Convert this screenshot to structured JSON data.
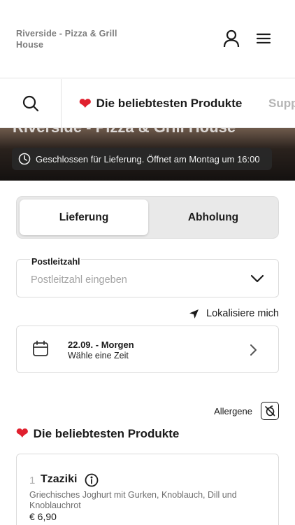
{
  "header": {
    "brand": "Riverside - Pizza & Grill House",
    "account_icon": "user-icon",
    "menu_icon": "hamburger-menu-icon"
  },
  "category_bar": {
    "search_icon": "search-icon",
    "items": [
      {
        "label": "Die beliebtesten Produkte",
        "icon": "heart-icon"
      },
      {
        "label": "Supp"
      }
    ]
  },
  "hero": {
    "title": "Riverside - Pizza & Grill House",
    "status": "Geschlossen für Lieferung. Öffnet am Montag um 16:00",
    "status_icon": "clock-icon"
  },
  "order_mode": {
    "options": [
      "Lieferung",
      "Abholung"
    ],
    "selected": "Lieferung"
  },
  "postcode": {
    "label": "Postleitzahl",
    "placeholder": "Postleitzahl eingeben",
    "value": ""
  },
  "locate": {
    "label": "Lokalisiere mich",
    "icon": "navigation-arrow-icon"
  },
  "date_selector": {
    "title": "22.09. - Morgen",
    "subtitle": "Wähle eine Zeit",
    "icon": "calendar-icon"
  },
  "allergens": {
    "label": "Allergene",
    "icon": "allergen-filter-icon"
  },
  "section": {
    "title": "Die beliebtesten Produkte",
    "icon": "heart-icon"
  },
  "products": [
    {
      "qty": "1",
      "name": "Tzaziki",
      "description": "Griechisches Joghurt mit Gurken, Knoblauch, Dill und Knoblauchrot",
      "price": "€ 6,90"
    }
  ],
  "colors": {
    "accent_heart": "#e0202e",
    "text": "#1b1b1b",
    "muted": "#7c7c7c",
    "border": "#dcdcdc",
    "segment_bg": "#e9e9e9"
  }
}
